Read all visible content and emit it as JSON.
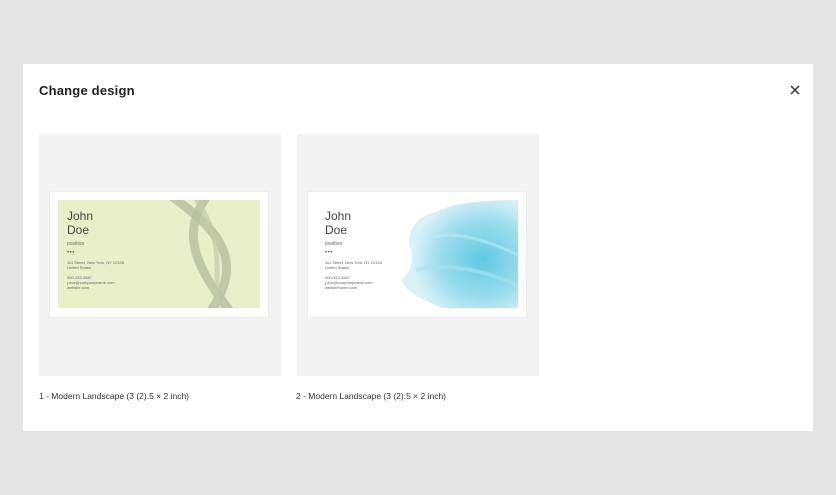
{
  "dialog": {
    "title": "Change design",
    "close_icon": "close-icon"
  },
  "designs": [
    {
      "caption": "1 - Modern Landscape (3 (2).5 × 2 inch)",
      "card": {
        "first_name": "John",
        "last_name": "Doe",
        "position": "position",
        "dots": "•••",
        "address_line1": "111 Street, New York, NY 12345,",
        "address_line2": "United States",
        "phone": "000-123-4567",
        "email": "j.doe@companyname.com",
        "website": "website.com",
        "background_color": "#e9f0c9",
        "accent_color": "#b9c1a2"
      }
    },
    {
      "caption": "2 - Modern Landscape (3 (2).5 × 2 inch)",
      "card": {
        "first_name": "John",
        "last_name": "Doe",
        "position": "position",
        "dots": "•••",
        "address_line1": "111 Street, New York, NY 12345,",
        "address_line2": "United States",
        "phone": "000-123-4567",
        "email": "j.doe@companyname.com",
        "website": "websitename.com",
        "background_color": "#ffffff",
        "accent_color": "#5ec8e0"
      }
    }
  ]
}
